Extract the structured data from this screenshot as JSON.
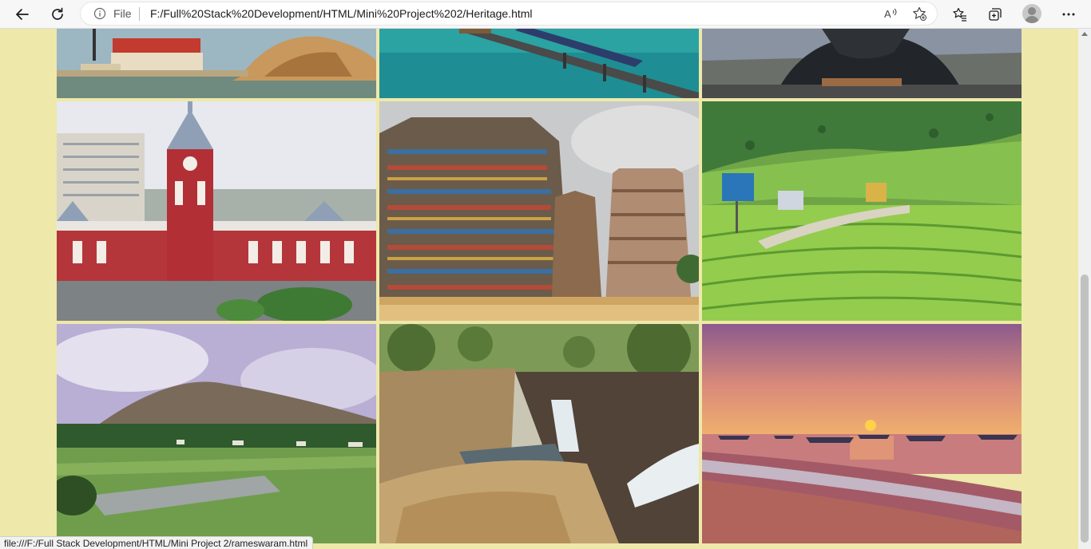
{
  "browser": {
    "scheme_label": "File",
    "url": "F:/Full%20Stack%20Development/HTML/Mini%20Project%202/Heritage.html",
    "status_link": "file:///F:/Full Stack Development/HTML/Mini Project 2/rameswaram.html",
    "icons": [
      "back-arrow-icon",
      "refresh-icon",
      "info-icon",
      "read-aloud-icon",
      "add-favorite-icon",
      "favorites-icon",
      "collections-icon",
      "profile-avatar-icon",
      "more-options-icon"
    ]
  },
  "page": {
    "background": "#eee8aa"
  },
  "gallery": {
    "rows": [
      {
        "tiles": [
          "coastal-town-rocks-image",
          "pamban-bridge-train-image",
          "adiyogi-statue-image"
        ]
      },
      {
        "tiles": [
          "chennai-central-station-image",
          "temple-gopuram-image",
          "tea-plantation-hills-image"
        ]
      },
      {
        "tiles": [
          "hill-paddy-fields-image",
          "waterfall-gorge-image",
          "sunset-beach-boats-image"
        ]
      }
    ]
  }
}
